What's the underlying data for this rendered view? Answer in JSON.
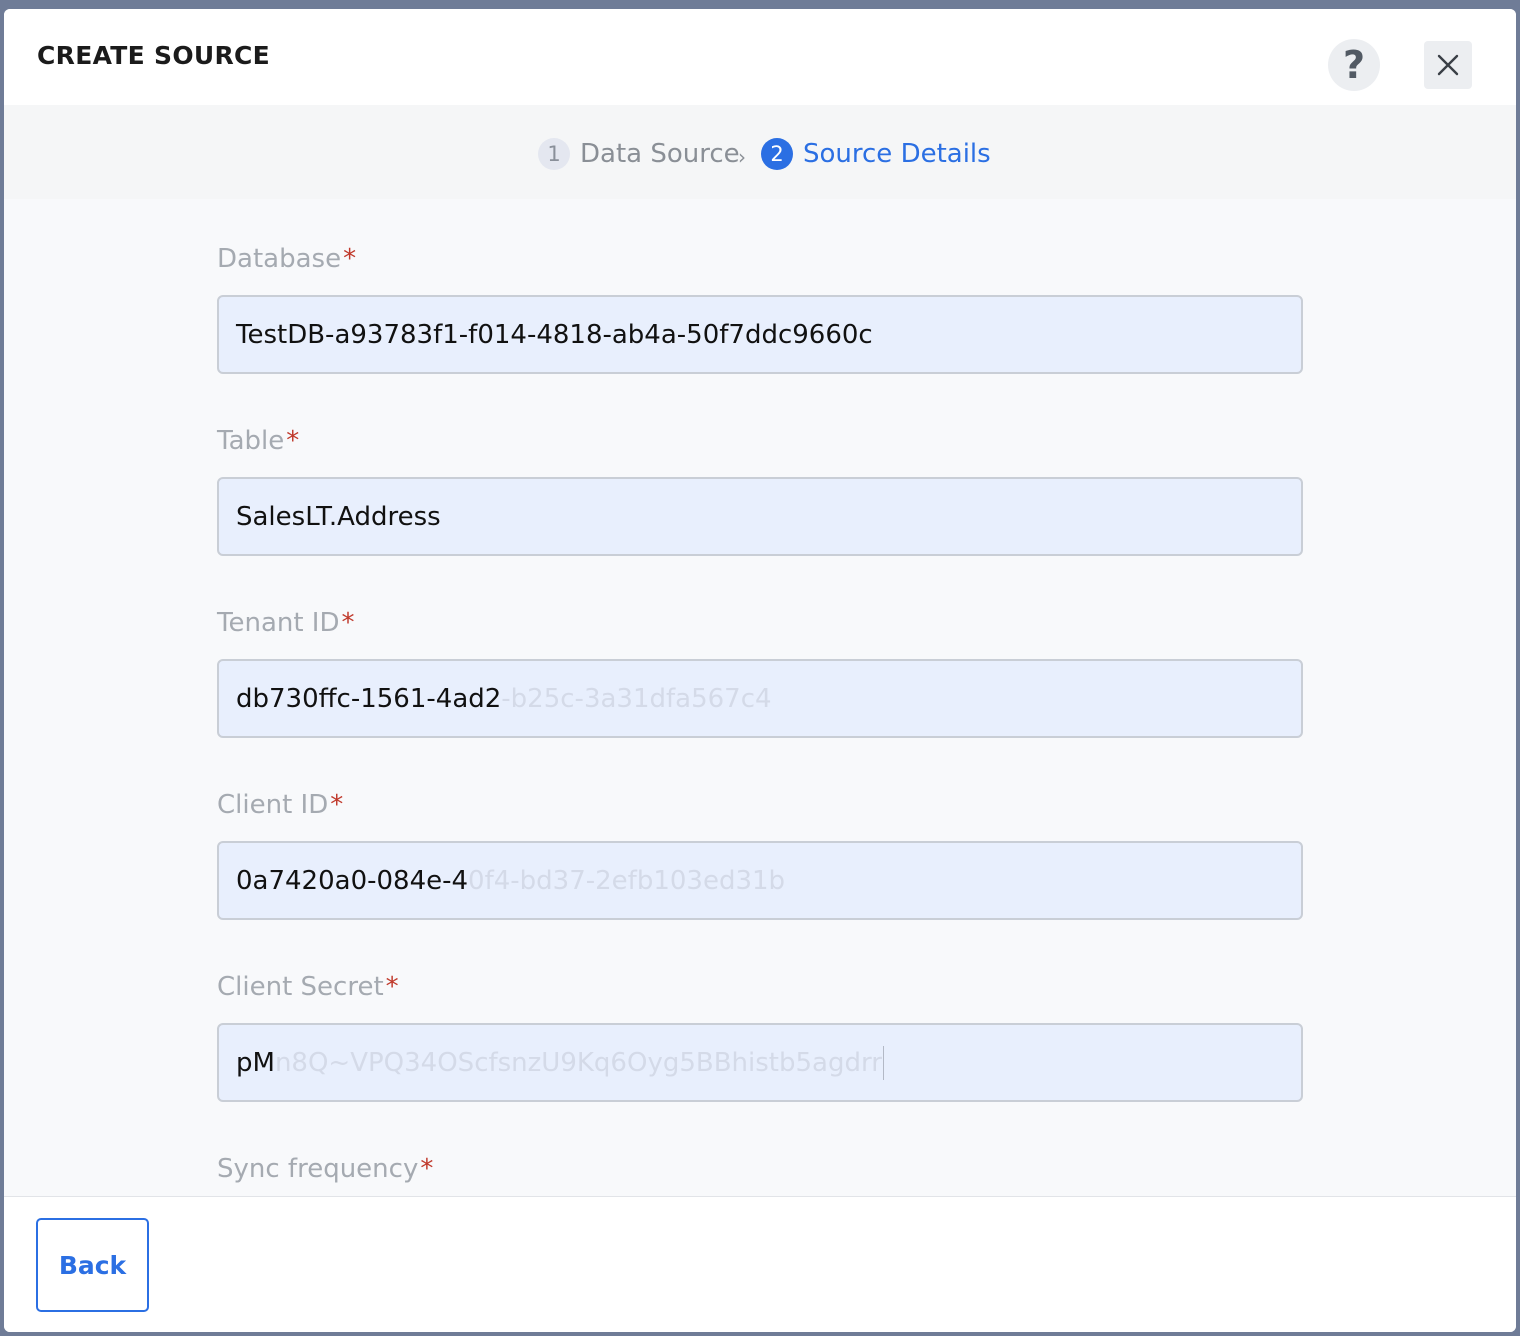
{
  "modal": {
    "title": "CREATE SOURCE",
    "help_label": "?",
    "close_label": "close"
  },
  "stepper": {
    "steps": [
      {
        "number": "1",
        "label": "Data Source",
        "state": "completed"
      },
      {
        "number": "2",
        "label": "Source Details",
        "state": "active"
      }
    ],
    "separator": "›"
  },
  "form": {
    "required_marker": "*",
    "fields": [
      {
        "label": "Database",
        "value": "TestDB-a93783f1-f014-4818-ab4a-50f7ddc9660c",
        "value_faded": ""
      },
      {
        "label": "Table",
        "value": "SalesLT.Address",
        "value_faded": ""
      },
      {
        "label": "Tenant ID",
        "value": "db730ffc-1561-4ad2",
        "value_faded": "-b25c-3a31dfa567c4"
      },
      {
        "label": "Client ID",
        "value": "0a7420a0-084e-4",
        "value_faded": "0f4-bd37-2efb103ed31b"
      },
      {
        "label": "Client Secret",
        "value": "pM",
        "value_faded": "n8Q~VPQ34OScfsnzU9Kq6Oyg5BBhistb5agdrr"
      },
      {
        "label": "Sync frequency",
        "value": "",
        "value_faded": ""
      }
    ]
  },
  "footer": {
    "back_label": "Back"
  },
  "colors": {
    "accent": "#2b6fe3",
    "required": "#c0392b",
    "input_bg": "#e8effd"
  }
}
